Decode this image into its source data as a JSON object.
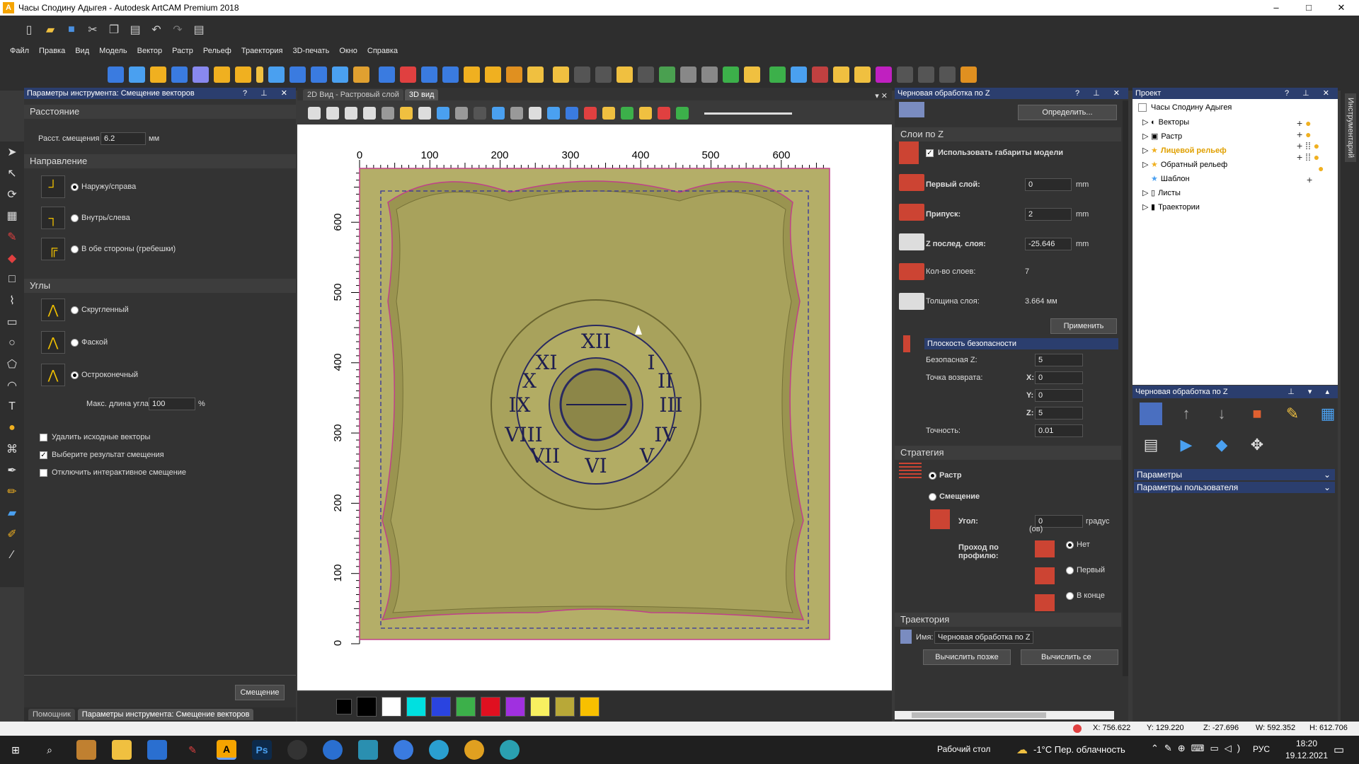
{
  "window": {
    "title": "Часы Сподину Адыгея - Autodesk ArtCAM Premium 2018",
    "min": "–",
    "max": "□",
    "close": "✕"
  },
  "menu": [
    "Файл",
    "Правка",
    "Вид",
    "Модель",
    "Вектор",
    "Растр",
    "Рельеф",
    "Траектория",
    "3D-печать",
    "Окно",
    "Справка"
  ],
  "tool_panel": {
    "title": "Параметры инструмента: Смещение векторов",
    "distance_section": "Расстояние",
    "offset_label": "Расст. смещения",
    "offset_value": "6.2",
    "offset_unit": "мм",
    "direction_section": "Направление",
    "dir_outside": "Наружу/справа",
    "dir_inside": "Внутрь/слева",
    "dir_both": "В обе стороны (гребешки)",
    "corners_section": "Углы",
    "corner_round": "Скругленный",
    "corner_chamfer": "Фаской",
    "corner_sharp": "Остроконечный",
    "max_angle_label": "Макс. длина угла",
    "max_angle_value": "100",
    "max_angle_unit": "%",
    "opt_delete": "Удалить исходные векторы",
    "opt_select": "Выберите результат смещения",
    "opt_disable": "Отключить интерактивное смещение",
    "apply_button": "Смещение",
    "tab_helper": "Помощник",
    "tab_params": "Параметры инструмента: Смещение векторов"
  },
  "view": {
    "tab2d": "2D Вид - Растровый слой",
    "tab3d": "3D вид",
    "xticks": [
      "0",
      "100",
      "200",
      "300",
      "400",
      "500",
      "600"
    ],
    "yticks": [
      "600",
      "500",
      "400",
      "300",
      "200",
      "100",
      "0"
    ]
  },
  "palette": {
    "colors": [
      "#000000",
      "#ffffff",
      "#00e0e0",
      "#2a44e0",
      "#3cb04a",
      "#e01020",
      "#a030e0",
      "#f8f060",
      "#b8a838",
      "#f8c000"
    ]
  },
  "zpanel": {
    "title": "Черновая обработка по Z",
    "define_button": "Определить...",
    "layers_section": "Слои по Z",
    "use_model": "Использовать габариты модели",
    "first_layer_label": "Первый слой:",
    "first_layer_value": "0",
    "allowance_label": "Припуск:",
    "allowance_value": "2",
    "z_last_label": "Z послед. слоя:",
    "z_last_value": "-25.646",
    "unit_mm": "mm",
    "count_label": "Кол-во слоев:",
    "count_value": "7",
    "thickness_label": "Толщина слоя:",
    "thickness_value": "3.664 мм",
    "apply_button": "Применить",
    "safety_header": "Плоскость безопасности",
    "safe_z_label": "Безопасная Z:",
    "safe_z_value": "5",
    "return_label": "Точка возврата:",
    "x_label": "X:",
    "x_value": "0",
    "y_label": "Y:",
    "y_value": "0",
    "z_label": "Z:",
    "z_value": "5",
    "accuracy_label": "Точность:",
    "accuracy_value": "0.01",
    "strategy_section": "Стратегия",
    "raster": "Растр",
    "offset": "Смещение",
    "angle_label": "Угол:",
    "angle_value": "0",
    "angle_unit": "градус",
    "angle_unit2": "(ов)",
    "profile_pass": "Проход по профилю:",
    "pass_none": "Нет",
    "pass_first": "Первый",
    "pass_last": "В конце",
    "toolpath_section": "Траектория",
    "name_label": "Имя:",
    "name_value": "Черновая обработка по Z",
    "calc_later": "Вычислить позже",
    "calc_now": "Вычислить се"
  },
  "project": {
    "title": "Проект",
    "root": "Часы Сподину Адыгея",
    "items": [
      "Векторы",
      "Растр",
      "Лицевой рельеф",
      "Обратный рельеф",
      "Шаблон",
      "Листы",
      "Траектории"
    ]
  },
  "rough": {
    "title": "Черновая обработка по Z",
    "params": "Параметры",
    "user_params": "Параметры пользователя"
  },
  "side_tab": "Инструментарий",
  "status": {
    "x": "X: 756.622",
    "y": "Y: 129.220",
    "z": "Z: -27.696",
    "w": "W: 592.352",
    "h": "H: 612.706"
  },
  "taskbar": {
    "desktop": "Рабочий стол",
    "weather": "-1°C  Пер. облачность",
    "lang": "РУС",
    "time": "18:20",
    "date": "19.12.2021"
  }
}
